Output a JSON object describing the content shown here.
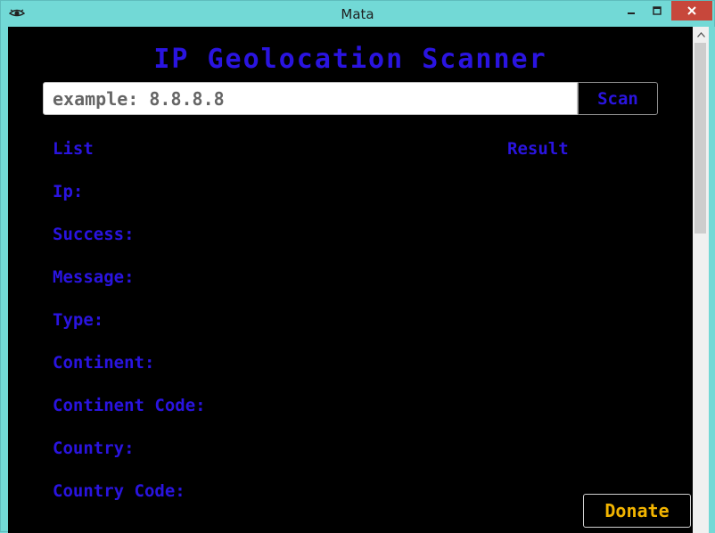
{
  "window": {
    "title": "Mata",
    "icon": "eye-icon"
  },
  "header": {
    "title": "IP Geolocation Scanner"
  },
  "search": {
    "placeholder": "example: 8.8.8.8",
    "value": "",
    "scan_label": "Scan"
  },
  "results": {
    "list_header": "List",
    "result_header": "Result",
    "fields": [
      {
        "label": "Ip:",
        "value": ""
      },
      {
        "label": "Success:",
        "value": ""
      },
      {
        "label": "Message:",
        "value": ""
      },
      {
        "label": "Type:",
        "value": ""
      },
      {
        "label": "Continent:",
        "value": ""
      },
      {
        "label": "Continent Code:",
        "value": ""
      },
      {
        "label": "Country:",
        "value": ""
      },
      {
        "label": "Country Code:",
        "value": ""
      }
    ]
  },
  "donate": {
    "label": "Donate"
  },
  "colors": {
    "accent": "#2a14e0",
    "donate": "#f2b400",
    "background": "#000000",
    "frame": "#72d9d6",
    "close": "#c7473b"
  }
}
